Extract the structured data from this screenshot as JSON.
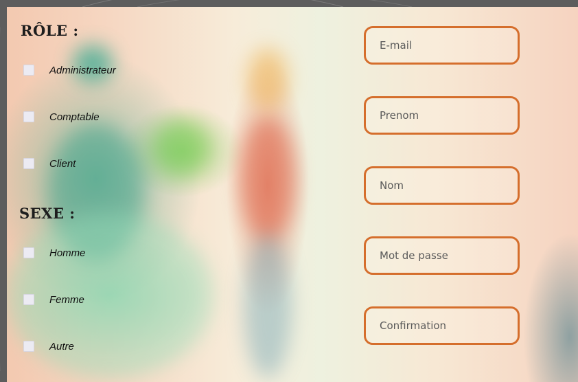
{
  "role": {
    "heading": "RÔLE :",
    "options": [
      {
        "label": "Administrateur",
        "checked": false
      },
      {
        "label": "Comptable",
        "checked": false
      },
      {
        "label": "Client",
        "checked": false
      }
    ]
  },
  "sexe": {
    "heading": "SEXE :",
    "options": [
      {
        "label": "Homme",
        "checked": false
      },
      {
        "label": "Femme",
        "checked": false
      },
      {
        "label": "Autre",
        "checked": false
      }
    ]
  },
  "fields": {
    "email": {
      "placeholder": "E-mail",
      "value": ""
    },
    "prenom": {
      "placeholder": "Prenom",
      "value": ""
    },
    "nom": {
      "placeholder": "Nom",
      "value": ""
    },
    "password": {
      "placeholder": "Mot de passe",
      "value": ""
    },
    "confirmation": {
      "placeholder": "Confirmation",
      "value": ""
    }
  },
  "colors": {
    "field_border": "#d56e2c",
    "checkbox_fill": "#ecebf3",
    "frame": "#5d5d5d"
  }
}
